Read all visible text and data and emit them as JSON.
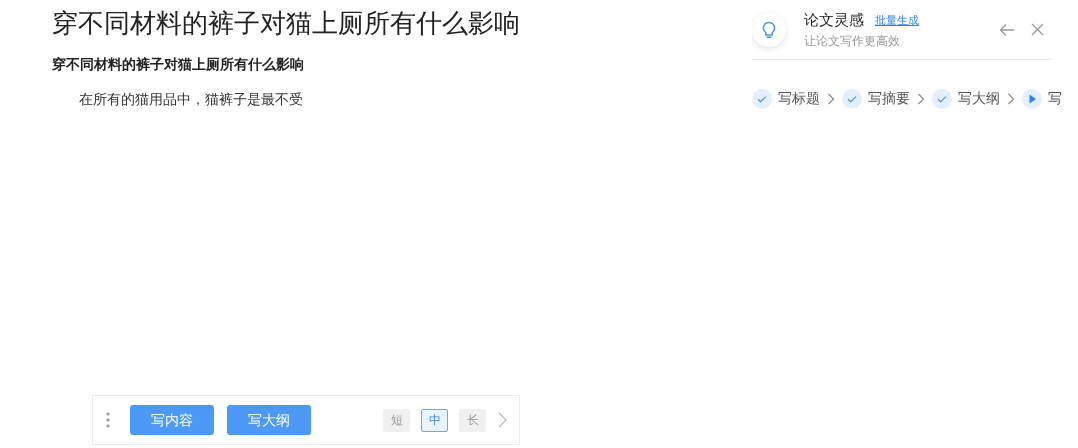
{
  "document": {
    "title": "穿不同材料的裤子对猫上厕所有什么影响",
    "subtitle": "穿不同材料的裤子对猫上厕所有什么影响",
    "paragraph": "在所有的猫用品中，猫裤子是最不受"
  },
  "toolbar": {
    "buttons": [
      "写内容",
      "写大纲"
    ],
    "lengths": [
      {
        "label": "短",
        "selected": false
      },
      {
        "label": "中",
        "selected": true
      },
      {
        "label": "长",
        "selected": false
      }
    ]
  },
  "panel": {
    "title": "论文灵感",
    "link": "批量生成",
    "subtitle": "让论文写作更高效",
    "steps": [
      {
        "label": "写标题",
        "kind": "done"
      },
      {
        "label": "写摘要",
        "kind": "done"
      },
      {
        "label": "写大纲",
        "kind": "done"
      },
      {
        "label": "写",
        "kind": "current"
      }
    ]
  }
}
